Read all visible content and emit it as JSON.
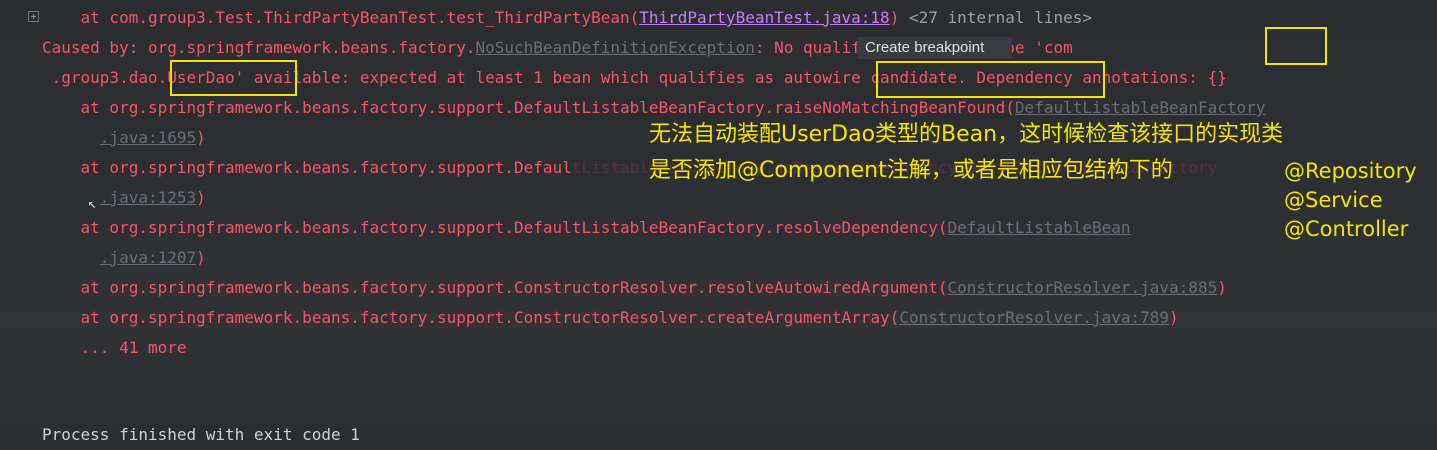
{
  "console": {
    "line1": {
      "prefix": "    at com.group3.Test.ThirdPartyBeanTest.test_ThirdPartyBean(",
      "link": "ThirdPartyBeanTest.java:18",
      "close": ")",
      "internal": " <27 internal lines>"
    },
    "line2": {
      "prefix": "Caused by: org.springframework.beans.factory.",
      "link": "NoSuchBeanDefinitionException",
      "rest": ": No qualifying bean of type 'com"
    },
    "line3": {
      "text": " .group3.dao.UserDao' available: expected at least 1 bean which qualifies as autowire candidate. Dependency annotations: {}"
    },
    "line4": {
      "prefix": "    at org.springframework.beans.factory.support.DefaultListableBeanFactory.raiseNoMatchingBeanFound(",
      "link": "DefaultListableBeanFactory"
    },
    "line5": {
      "link": ".java:1695",
      "close": ")"
    },
    "line6": {
      "prefix": "    at org.springframework.beans.factory.support.Defaul",
      "hidden": "tListableBeanFactory.doResolveDependency(DefaultListableBeanFactory"
    },
    "line7": {
      "link": ".java:1253",
      "close": ")"
    },
    "line8": {
      "prefix": "    at org.springframework.beans.factory.support.DefaultListableBeanFactory.resolveDependency(",
      "link": "DefaultListableBean"
    },
    "line9": {
      "link": ".java:1207",
      "close": ")"
    },
    "line10": {
      "prefix": "    at org.springframework.beans.factory.support.ConstructorResolver.resolveAutowiredArgument(",
      "link": "ConstructorResolver.java:885",
      "close": ")"
    },
    "line11": {
      "prefix": "    at org.springframework.beans.factory.support.ConstructorResolver.createArgumentArray(",
      "link": "ConstructorResolver.java:789",
      "close": ")"
    },
    "line12": {
      "text": "    ... 41 more"
    },
    "bottom": {
      "text": "Process finished with exit code 1"
    }
  },
  "tooltip": {
    "label": "Create breakpoint"
  },
  "annotation": {
    "line1": "无法自动装配UserDao类型的Bean，这时候检查该接口的实现类",
    "line2": "是否添加@Component注解，或者是相应包结构下的",
    "tags": [
      "@Repository",
      "@Service",
      "@Controller"
    ]
  },
  "colors": {
    "error_text": "#f75464",
    "highlight": "#f5e400",
    "annotation": "#f4e600",
    "background": "#2b2d30"
  }
}
